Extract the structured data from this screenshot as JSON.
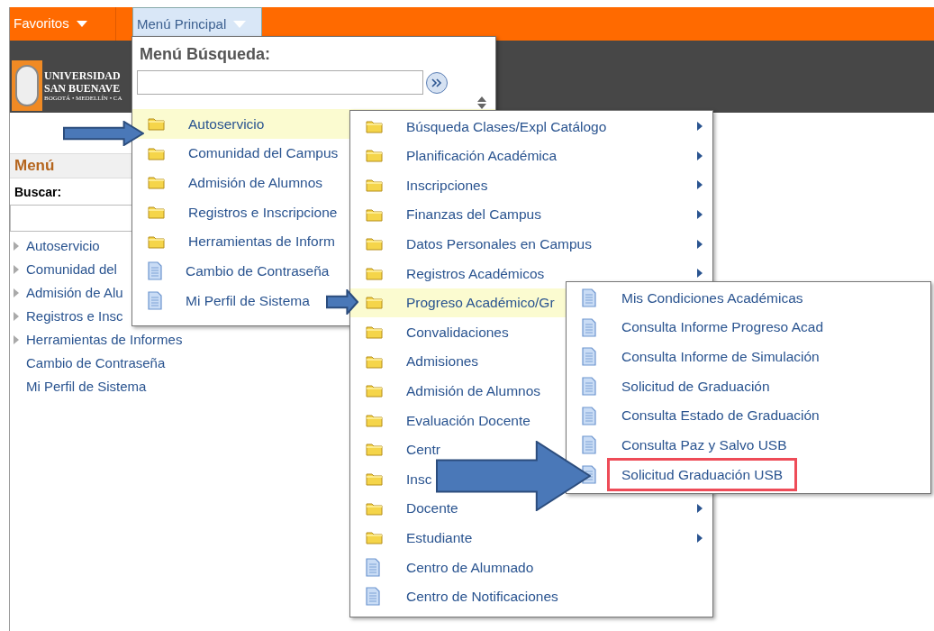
{
  "top_bar": {
    "favorites": "Favoritos",
    "main_menu": "Menú Principal"
  },
  "logo": {
    "line_1": "UNIVERSIDAD",
    "line_2": "SAN BUENAVE",
    "line_3": "BOGOTÁ • MEDELLÍN • CA"
  },
  "sidebar": {
    "title": "Menú",
    "search_label": "Buscar:",
    "items": [
      {
        "label": "Autoservicio",
        "kind": "folder"
      },
      {
        "label": "Comunidad del",
        "kind": "folder"
      },
      {
        "label": "Admisión de Alu",
        "kind": "folder"
      },
      {
        "label": "Registros e Insc",
        "kind": "folder"
      },
      {
        "label": "Herramientas de Informes",
        "kind": "folder"
      },
      {
        "label": "Cambio de Contraseña",
        "kind": "page"
      },
      {
        "label": "Mi Perfil de Sistema",
        "kind": "page"
      }
    ]
  },
  "main_menu_popup": {
    "title": "Menú Búsqueda:",
    "items": [
      {
        "label": "Autoservicio",
        "kind": "folder",
        "selected": true
      },
      {
        "label": "Comunidad del Campus",
        "kind": "folder",
        "selected": false
      },
      {
        "label": "Admisión de Alumnos",
        "kind": "folder",
        "selected": false
      },
      {
        "label": "Registros e Inscripcione",
        "kind": "folder",
        "selected": false
      },
      {
        "label": "Herramientas de Inform",
        "kind": "folder",
        "selected": false
      },
      {
        "label": "Cambio de Contraseña",
        "kind": "page",
        "selected": false
      },
      {
        "label": "Mi Perfil de Sistema",
        "kind": "page",
        "selected": false
      }
    ]
  },
  "submenu": {
    "items": [
      {
        "label": "Búsqueda Clases/Expl Catálogo",
        "kind": "folder",
        "selected": false,
        "has_submenu": true
      },
      {
        "label": "Planificación Académica",
        "kind": "folder",
        "selected": false,
        "has_submenu": true
      },
      {
        "label": "Inscripciones",
        "kind": "folder",
        "selected": false,
        "has_submenu": true
      },
      {
        "label": "Finanzas del Campus",
        "kind": "folder",
        "selected": false,
        "has_submenu": true
      },
      {
        "label": "Datos Personales en Campus",
        "kind": "folder",
        "selected": false,
        "has_submenu": true
      },
      {
        "label": "Registros Académicos",
        "kind": "folder",
        "selected": false,
        "has_submenu": true
      },
      {
        "label": "Progreso Académico/Gr",
        "kind": "folder",
        "selected": true
      },
      {
        "label": "Convalidaciones",
        "kind": "folder",
        "selected": false
      },
      {
        "label": "Admisiones",
        "kind": "folder",
        "selected": false
      },
      {
        "label": "Admisión de Alumnos",
        "kind": "folder",
        "selected": false
      },
      {
        "label": "Evaluación Docente",
        "kind": "folder",
        "selected": false
      },
      {
        "label": "Centr",
        "kind": "folder",
        "selected": false
      },
      {
        "label": "Insc",
        "kind": "folder",
        "selected": false
      },
      {
        "label": "Docente",
        "kind": "folder",
        "selected": false,
        "has_submenu": true
      },
      {
        "label": "Estudiante",
        "kind": "folder",
        "selected": false,
        "has_submenu": true
      },
      {
        "label": "Centro de Alumnado",
        "kind": "page",
        "selected": false,
        "has_submenu": false
      },
      {
        "label": "Centro de Notificaciones",
        "kind": "page",
        "selected": false,
        "has_submenu": false
      }
    ]
  },
  "submenu_2": {
    "items": [
      {
        "label": "Mis Condiciones Académicas",
        "highlighted": false
      },
      {
        "label": "Consulta Informe Progreso Acad",
        "highlighted": false
      },
      {
        "label": "Consulta Informe de Simulación",
        "highlighted": false
      },
      {
        "label": "Solicitud de Graduación",
        "highlighted": false
      },
      {
        "label": "Consulta Estado de Graduación",
        "highlighted": false
      },
      {
        "label": "Consulta Paz y Salvo USB",
        "highlighted": false
      },
      {
        "label": "Solicitud Graduación USB",
        "highlighted": true
      }
    ]
  }
}
